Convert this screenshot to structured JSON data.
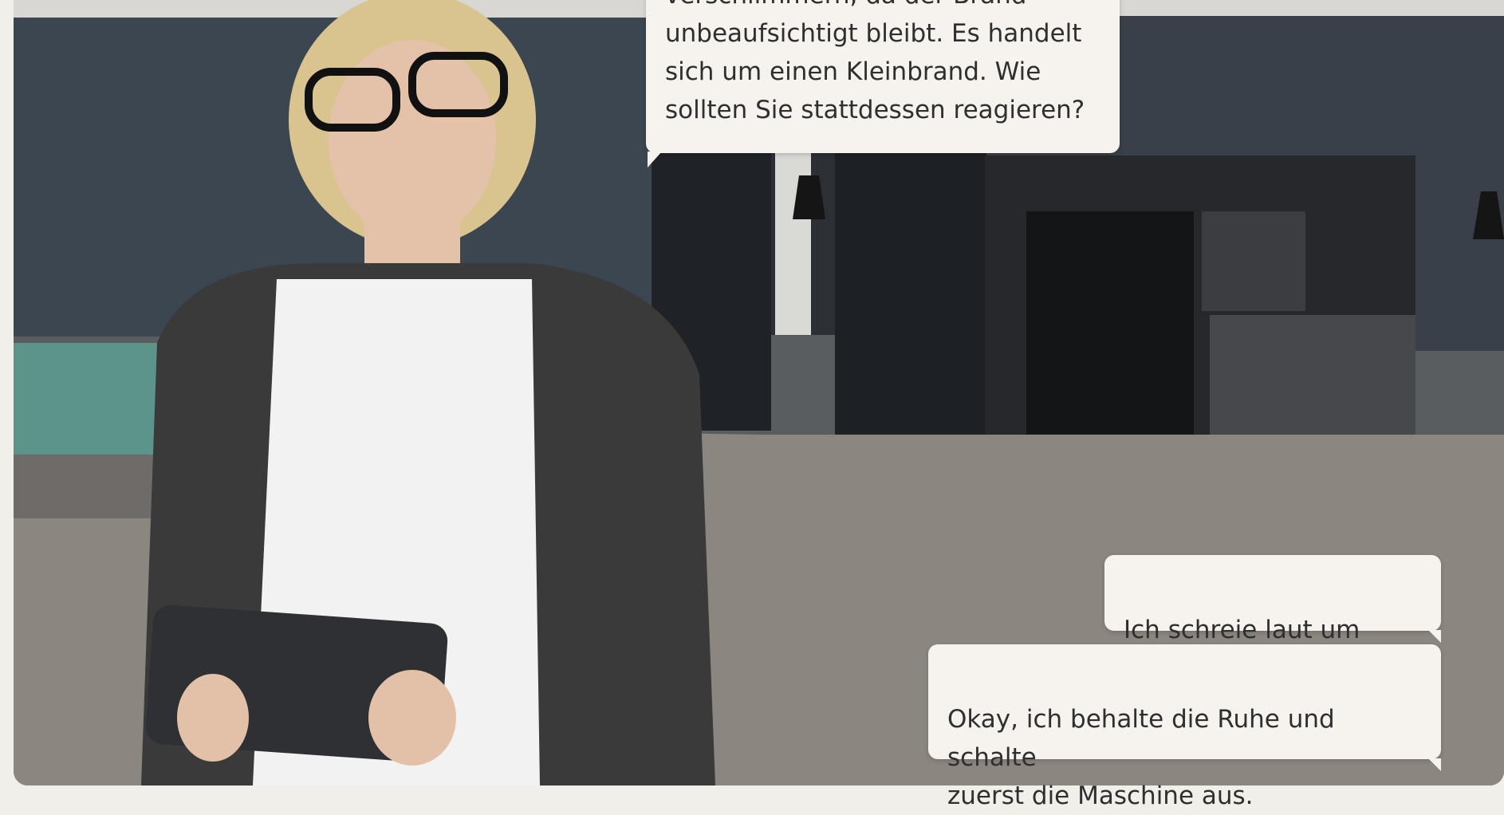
{
  "scene": {
    "npc_dialog": {
      "lines": "verschlimmern, da der Brand\nunbeaufsichtigt bleibt. Es handelt\nsich um einen Kleinbrand. Wie\nsollten Sie stattdessen reagieren?"
    },
    "options": [
      {
        "label": "Ich schreie laut um Hilfe."
      },
      {
        "label": "Okay, ich behalte die Ruhe und schalte\nzuerst die Maschine aus."
      }
    ]
  },
  "colors": {
    "bubble_bg": "#f6f3ee",
    "bubble_text": "#2f2f2f",
    "page_bg": "#f1efe9"
  }
}
